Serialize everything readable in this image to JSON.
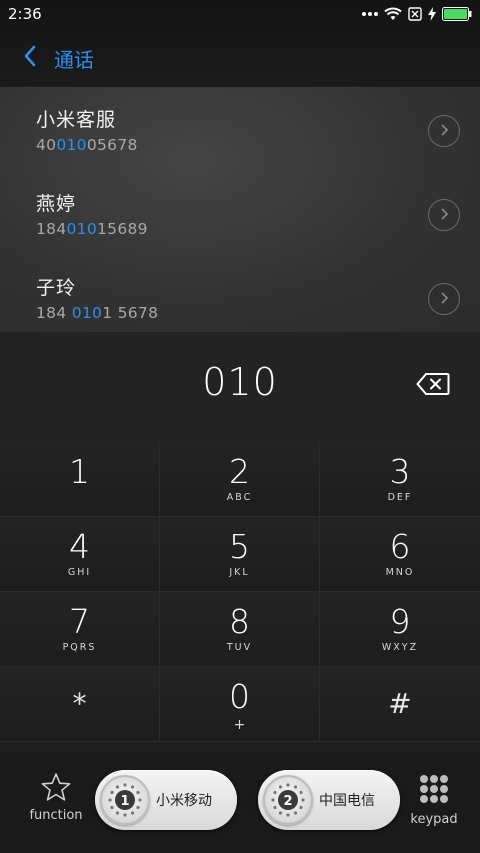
{
  "status_bar": {
    "time": "2:36"
  },
  "header": {
    "title": "通话"
  },
  "results": [
    {
      "name": "小米客服",
      "number_parts": [
        "40",
        "010",
        "05678"
      ]
    },
    {
      "name": "燕婷",
      "number_parts": [
        "184",
        "010",
        "15689"
      ]
    },
    {
      "name": "子玲",
      "number_parts": [
        "184 ",
        "010",
        "1 5678"
      ]
    }
  ],
  "dial": {
    "number": "010"
  },
  "keys": [
    {
      "digit": "1",
      "letters": ""
    },
    {
      "digit": "2",
      "letters": "ABC"
    },
    {
      "digit": "3",
      "letters": "DEF"
    },
    {
      "digit": "4",
      "letters": "GHI"
    },
    {
      "digit": "5",
      "letters": "JKL"
    },
    {
      "digit": "6",
      "letters": "MNO"
    },
    {
      "digit": "7",
      "letters": "PQRS"
    },
    {
      "digit": "8",
      "letters": "TUV"
    },
    {
      "digit": "9",
      "letters": "WXYZ"
    },
    {
      "digit": "*",
      "letters": ""
    },
    {
      "digit": "0",
      "letters": "+"
    },
    {
      "digit": "#",
      "letters": ""
    }
  ],
  "bottom": {
    "function_label": "function",
    "sim1_label": "小米移动",
    "sim1_number": "1",
    "sim2_label": "中国电信",
    "sim2_number": "2",
    "keypad_label": "keypad"
  },
  "colors": {
    "accent": "#2a8ff0",
    "battery": "#4cd964"
  },
  "icons": [
    "wifi-icon",
    "no-sim-icon",
    "charging-icon",
    "battery-icon",
    "back-chevron-icon",
    "chevron-right-icon",
    "backspace-icon",
    "star-icon",
    "keypad-grid-icon"
  ]
}
